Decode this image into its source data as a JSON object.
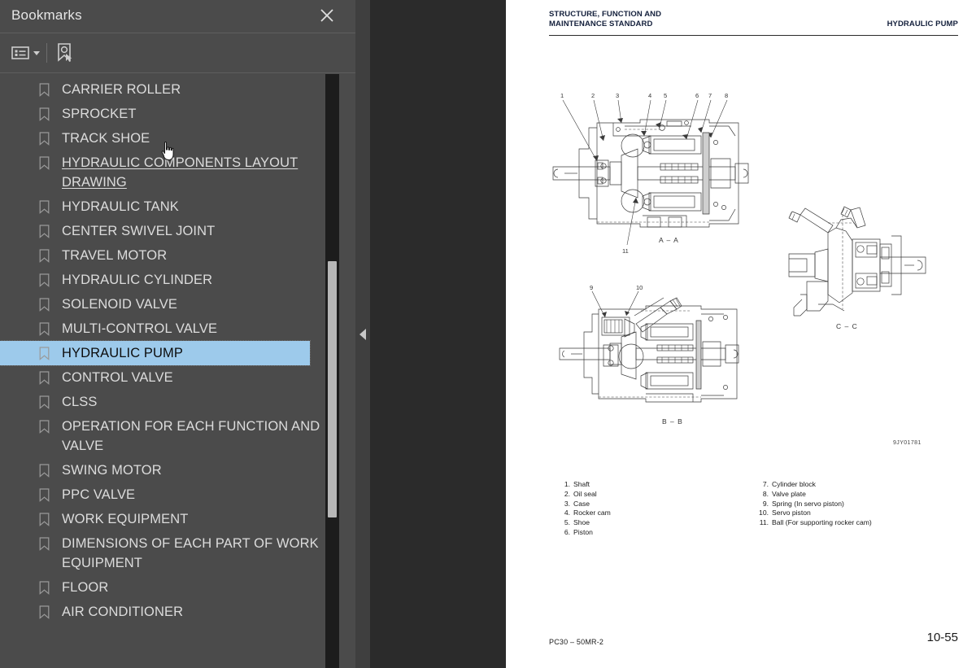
{
  "sidebar": {
    "title": "Bookmarks",
    "close_icon": "close-icon",
    "toolbar": {
      "options_icon": "list-options-icon",
      "options_caret_icon": "chevron-down-icon",
      "new_bookmark_icon": "new-bookmark-icon"
    },
    "items": [
      {
        "label": "CARRIER ROLLER",
        "state": "normal"
      },
      {
        "label": "SPROCKET",
        "state": "normal"
      },
      {
        "label": "TRACK SHOE",
        "state": "normal"
      },
      {
        "label": "HYDRAULIC COMPONENTS LAYOUT DRAWING",
        "state": "underlined"
      },
      {
        "label": "HYDRAULIC TANK",
        "state": "normal"
      },
      {
        "label": "CENTER SWIVEL JOINT",
        "state": "normal"
      },
      {
        "label": "TRAVEL MOTOR",
        "state": "normal"
      },
      {
        "label": "HYDRAULIC CYLINDER",
        "state": "normal"
      },
      {
        "label": "SOLENOID VALVE",
        "state": "normal"
      },
      {
        "label": "MULTI-CONTROL VALVE",
        "state": "normal"
      },
      {
        "label": "HYDRAULIC PUMP",
        "state": "selected"
      },
      {
        "label": "CONTROL VALVE",
        "state": "normal"
      },
      {
        "label": "CLSS",
        "state": "normal"
      },
      {
        "label": "OPERATION FOR EACH FUNCTION AND VALVE",
        "state": "normal"
      },
      {
        "label": "SWING MOTOR",
        "state": "normal"
      },
      {
        "label": "PPC VALVE",
        "state": "normal"
      },
      {
        "label": "WORK EQUIPMENT",
        "state": "normal"
      },
      {
        "label": "DIMENSIONS OF EACH PART OF WORK EQUIPMENT",
        "state": "normal"
      },
      {
        "label": "FLOOR",
        "state": "normal"
      },
      {
        "label": "AIR CONDITIONER",
        "state": "normal"
      }
    ],
    "selection_color": "#9dcaeb",
    "panel_color": "#4b4b4b"
  },
  "viewer": {
    "collapse_icon": "triangle-left-icon",
    "backdrop_color": "#2b2b2b"
  },
  "document": {
    "header_line1": "STRUCTURE, FUNCTION AND",
    "header_line2": "MAINTENANCE STANDARD",
    "header_right": "HYDRAULIC PUMP",
    "figures": [
      {
        "caption": "A – A",
        "name": "section-a-a"
      },
      {
        "caption": "B – B",
        "name": "section-b-b"
      },
      {
        "caption": "C – C",
        "name": "section-c-c"
      }
    ],
    "drawing_code": "9JY01781",
    "parts_left": [
      {
        "num": "1.",
        "name": "Shaft"
      },
      {
        "num": "2.",
        "name": "Oil seal"
      },
      {
        "num": "3.",
        "name": "Case"
      },
      {
        "num": "4.",
        "name": "Rocker cam"
      },
      {
        "num": "5.",
        "name": "Shoe"
      },
      {
        "num": "6.",
        "name": "Piston"
      }
    ],
    "parts_right": [
      {
        "num": "7.",
        "name": "Cylinder block"
      },
      {
        "num": "8.",
        "name": "Valve plate"
      },
      {
        "num": "9.",
        "name": "Spring (In servo piston)"
      },
      {
        "num": "10.",
        "name": "Servo piston"
      },
      {
        "num": "11.",
        "name": "Ball (For supporting rocker cam)"
      }
    ],
    "footer_model": "PC30 – 50MR-2",
    "footer_page": "10-55",
    "callouts_a": [
      "1",
      "2",
      "3",
      "4",
      "5",
      "6",
      "7",
      "8",
      "11"
    ],
    "callouts_b": [
      "9",
      "10"
    ]
  }
}
